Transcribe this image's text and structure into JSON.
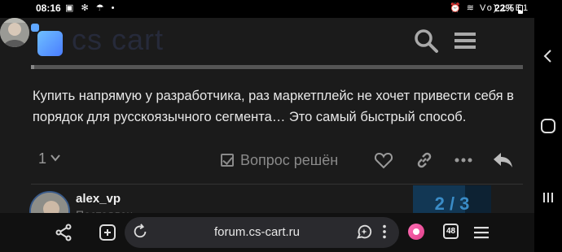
{
  "status_bar": {
    "time": "08:16",
    "left_icons": "▣ ✻ ☂ •",
    "right_icons": "⏰ ≋ Vo) LTE1 .ıl",
    "battery": "22%"
  },
  "header": {
    "logo_text": "cs cart",
    "search_icon": "search-icon",
    "menu_icon": "hamburger-menu-icon"
  },
  "post": {
    "text": "Купить напрямую у разработчика, раз маркетплейс не хочет привести себя в порядок для русскоязычного сегмента… Это самый быстрый способ.",
    "likes_count": "1",
    "solved_label": "Вопрос решён"
  },
  "next_post": {
    "username": "alex_vp",
    "role": "Постоялец"
  },
  "timeline": {
    "label": "2 / 3",
    "current": 2,
    "total": 3
  },
  "browser": {
    "url": "forum.cs-cart.ru",
    "tab_count": "48"
  },
  "colors": {
    "accent": "#3a8cc7",
    "logo_gradient_start": "#6fc0ff",
    "logo_gradient_end": "#4a7dff",
    "background": "#1b1b1b"
  }
}
